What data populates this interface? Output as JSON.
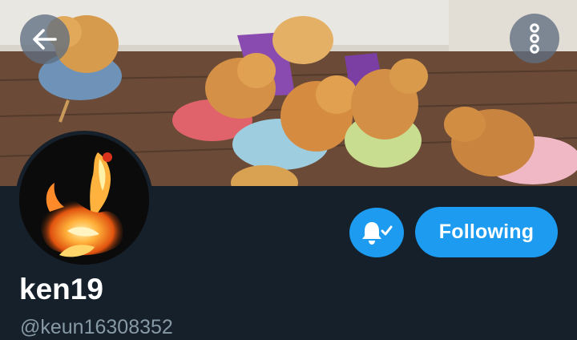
{
  "profile": {
    "display_name": "ken19",
    "handle": "@keun16308352"
  },
  "actions": {
    "following_label": "Following"
  },
  "icons": {
    "back": "arrow-left-icon",
    "more": "vertical-dots-icon",
    "notify": "bell-check-icon"
  },
  "colors": {
    "background": "#15202b",
    "accent": "#1d9bf0",
    "handle_text": "#8899a6",
    "name_text": "#ffffff"
  }
}
